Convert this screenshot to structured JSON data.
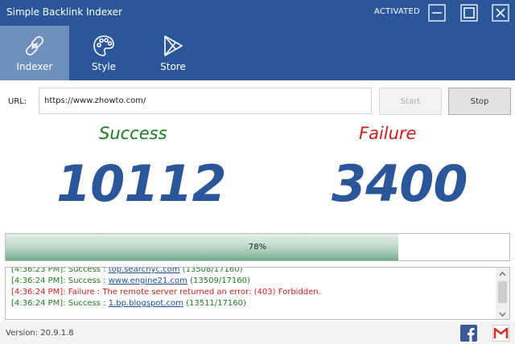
{
  "window": {
    "title": "Simple Backlink Indexer",
    "status": "ACTIVATED"
  },
  "toolbar": {
    "tabs": [
      {
        "label": "Indexer",
        "icon": "link-icon",
        "active": true
      },
      {
        "label": "Style",
        "icon": "palette-icon",
        "active": false
      },
      {
        "label": "Store",
        "icon": "play-store-icon",
        "active": false
      }
    ]
  },
  "form": {
    "url_label": "URL:",
    "url_value": "https://www.zhowto.com/",
    "start_label": "Start",
    "stop_label": "Stop"
  },
  "stats": {
    "success_label": "Success",
    "success_count": "10112",
    "failure_label": "Failure",
    "failure_count": "3400"
  },
  "progress": {
    "percent": 78,
    "label": "78%"
  },
  "log": {
    "lines": [
      {
        "time": "[4:36:23 PM]:",
        "status": "Success :",
        "link": "top.searchyc.com",
        "detail": "(13508/17160)",
        "type": "ok"
      },
      {
        "time": "[4:36:24 PM]:",
        "status": "Success :",
        "link": "www.engine21.com",
        "detail": "(13509/17160)",
        "type": "ok"
      },
      {
        "time": "[4:36:24 PM]:",
        "status": "Failure :",
        "link": "",
        "detail": "The remote server returned an error: (403) Forbidden.",
        "type": "err"
      },
      {
        "time": "[4:36:24 PM]:",
        "status": "Success :",
        "link": "1.bp.blogspot.com",
        "detail": "(13511/17160)",
        "type": "ok"
      }
    ]
  },
  "footer": {
    "version": "Version: 20.9.1.8"
  },
  "colors": {
    "brand": "#2b579a",
    "active_tab": "#6f8fbf",
    "success": "#1d7b1d",
    "failure": "#cc1c1c",
    "progress_fill": "#a5c8b3"
  }
}
